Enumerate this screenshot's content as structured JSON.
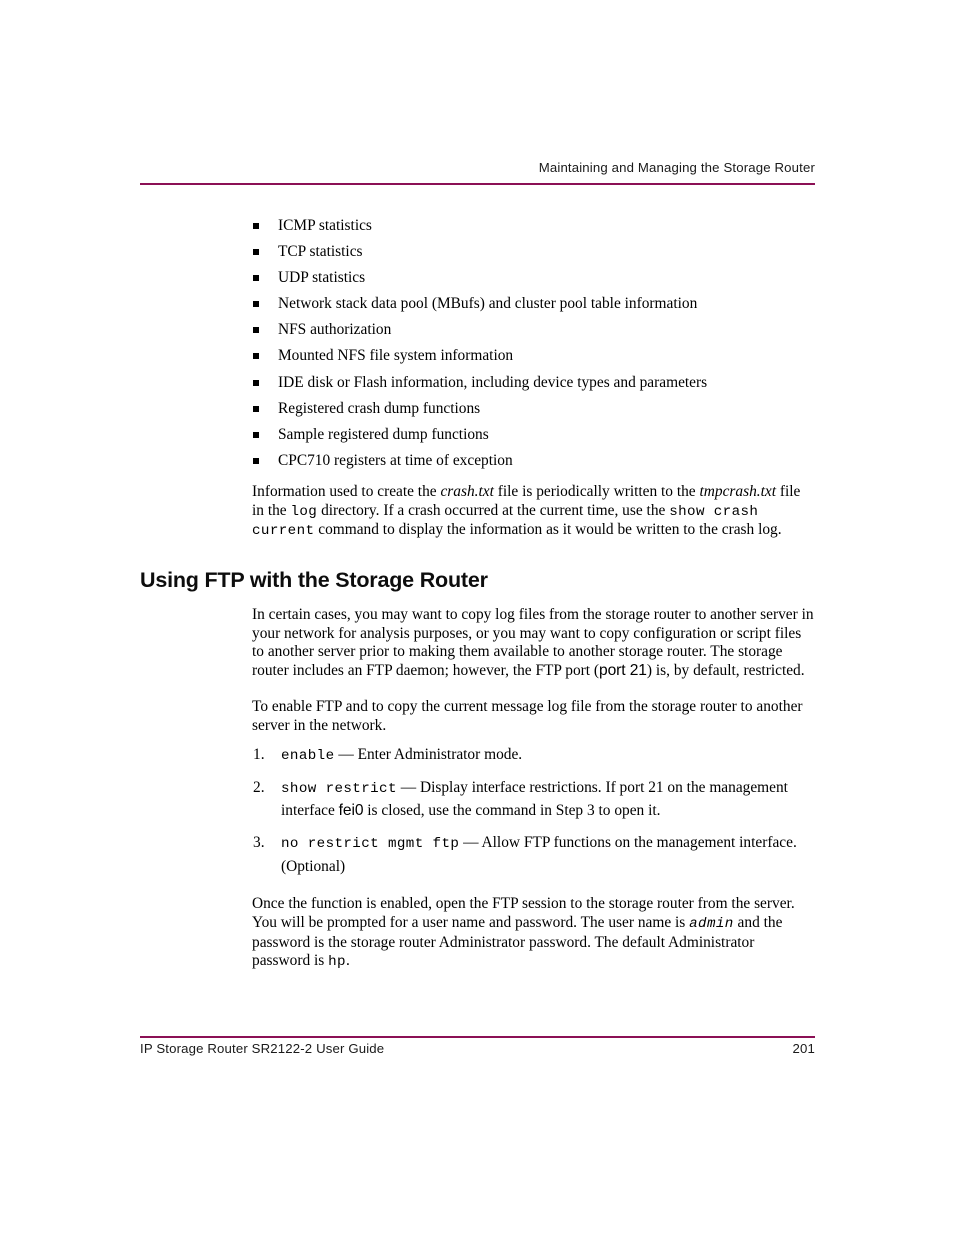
{
  "page": {
    "running_head": "Maintaining and Managing the Storage Router",
    "footer_title": "IP Storage Router SR2122-2 User Guide",
    "page_number": "201",
    "rule_color": "#8b1055"
  },
  "bullets": [
    {
      "text": "ICMP statistics"
    },
    {
      "text": "TCP statistics"
    },
    {
      "text": "UDP statistics"
    },
    {
      "text": "Network stack data pool (MBufs) and cluster pool table information"
    },
    {
      "text": "NFS authorization"
    },
    {
      "text": "Mounted NFS file system information"
    },
    {
      "text": "IDE disk or Flash information, including device types and parameters"
    },
    {
      "text": "Registered crash dump functions"
    },
    {
      "text": "Sample registered dump functions"
    },
    {
      "text": "CPC710 registers at time of exception"
    }
  ],
  "crash_paragraph": {
    "p1": "Information used to create the ",
    "file1": "crash.txt",
    "p2": " file is periodically written to the ",
    "file2": "tmpcrash.txt",
    "p3": " file in the ",
    "cmd1": "log",
    "p4": " directory. If a crash occurred at the current time, use the ",
    "cmd2": "show crash current",
    "p5": " command to display the information as it would be written to the crash log."
  },
  "section": {
    "heading": "Using FTP with the Storage Router"
  },
  "intro_paragraph": {
    "p1": "In certain cases, you may want to copy log files from the storage router to another server in your network for analysis purposes, or you may want to copy configuration or script files to another server prior to making them available to another storage router. The storage router includes an FTP daemon; however, the FTP port (",
    "port": "port 21",
    "p2": ") is, by default, restricted."
  },
  "enable_paragraph": {
    "text": "To enable FTP and to copy the current message log file from the storage router to another server in the network."
  },
  "steps": [
    {
      "num": "1.",
      "cmd": "enable",
      "dash": " — ",
      "desc": "Enter Administrator mode.",
      "cmd2": "",
      "desc2": ""
    },
    {
      "num": "2.",
      "cmd": "show restrict",
      "dash": "  —  ",
      "desc": "Display interface restrictions. If port 21 on the management interface ",
      "cmd2": "fei0",
      "desc2": " is closed, use the command in Step 3 to open it."
    },
    {
      "num": "3.",
      "cmd": "no restrict mgmt ftp",
      "dash": " — ",
      "desc": "Allow FTP functions on the management interface. (Optional)",
      "cmd2": "",
      "desc2": ""
    }
  ],
  "closing_paragraph": {
    "p1": "Once the function is enabled, open the FTP session to the storage router from the server. You will be prompted for a user name and password. The user name is ",
    "user": "admin",
    "p2": " and the password is the storage router Administrator password. The default Administrator password is ",
    "pass": "hp",
    "p3": "."
  }
}
